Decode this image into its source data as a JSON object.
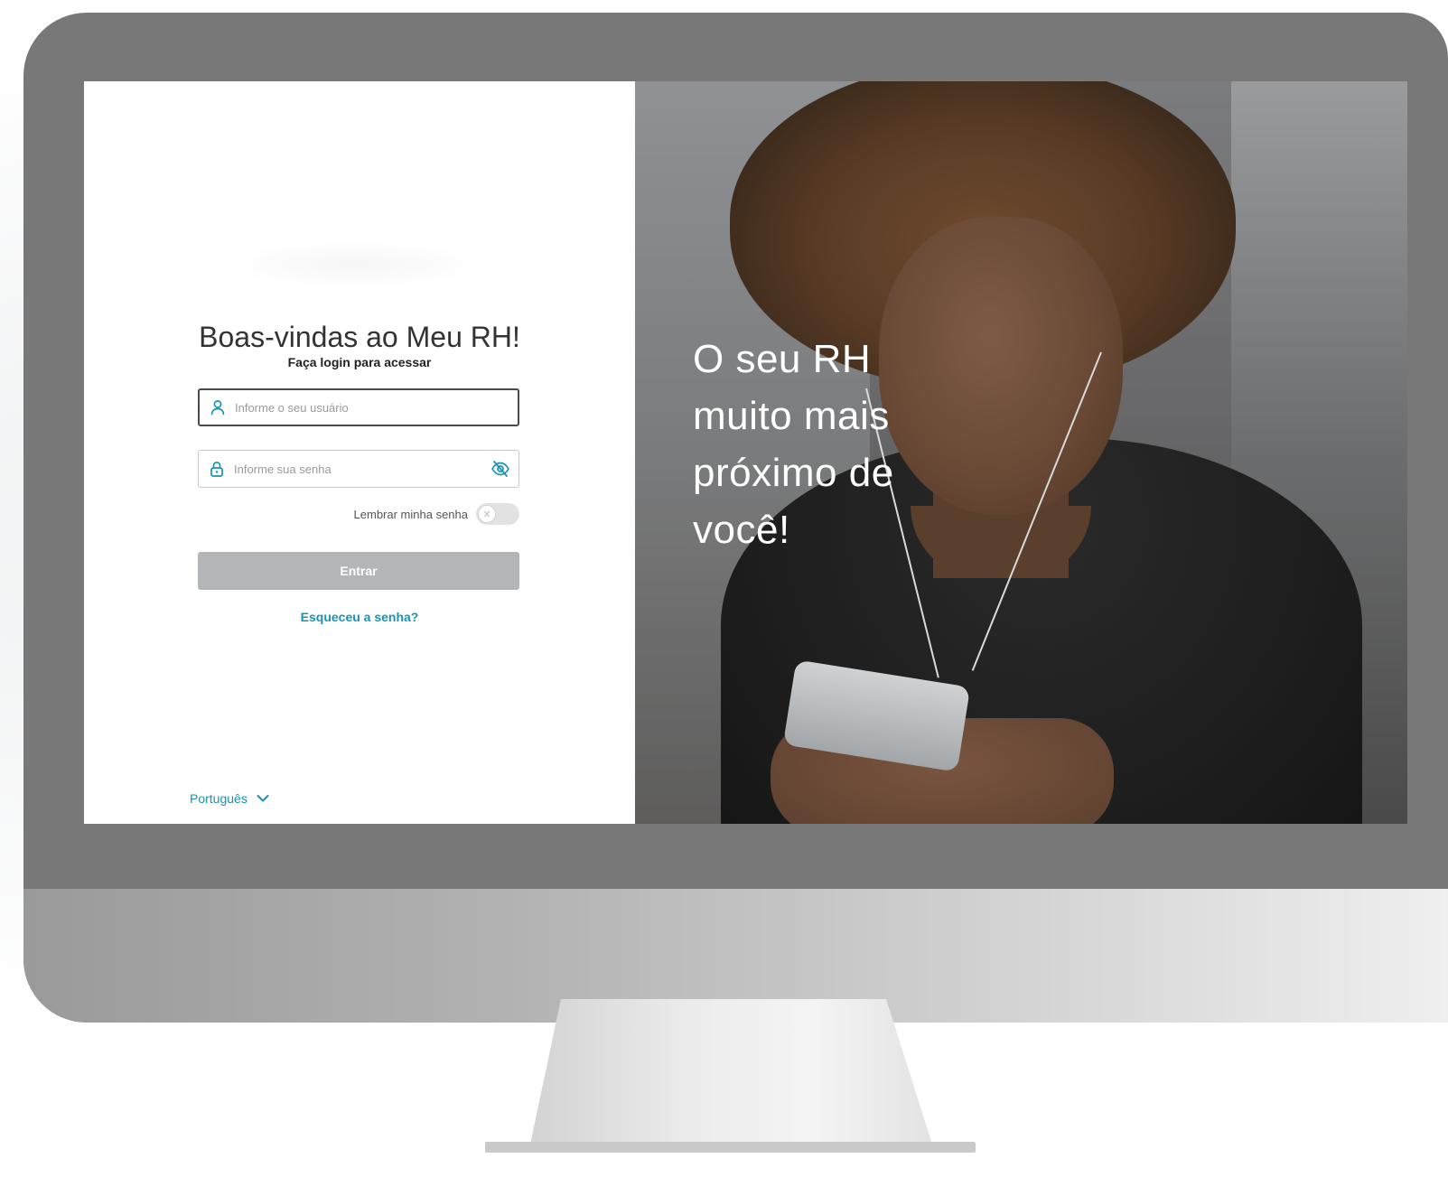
{
  "login": {
    "title": "Boas-vindas ao Meu RH!",
    "subtitle": "Faça login para acessar",
    "username_placeholder": "Informe o seu usuário",
    "password_placeholder": "Informe sua senha",
    "remember_label": "Lembrar minha senha",
    "remember_enabled": false,
    "enter_label": "Entrar",
    "forgot_label": "Esqueceu a senha?",
    "language": "Português"
  },
  "hero": {
    "lines": [
      "O seu RH",
      "muito mais",
      "próximo de",
      "você!"
    ]
  },
  "icons": {
    "user": "user-icon",
    "lock": "lock-icon",
    "eye": "eye-off-icon",
    "toggle_knob": "x-icon",
    "language_chevron": "chevron-down-icon"
  },
  "colors": {
    "accent": "#1a93b0",
    "button_disabled": "#b3b6b8",
    "monitor_bezel": "#787878"
  }
}
